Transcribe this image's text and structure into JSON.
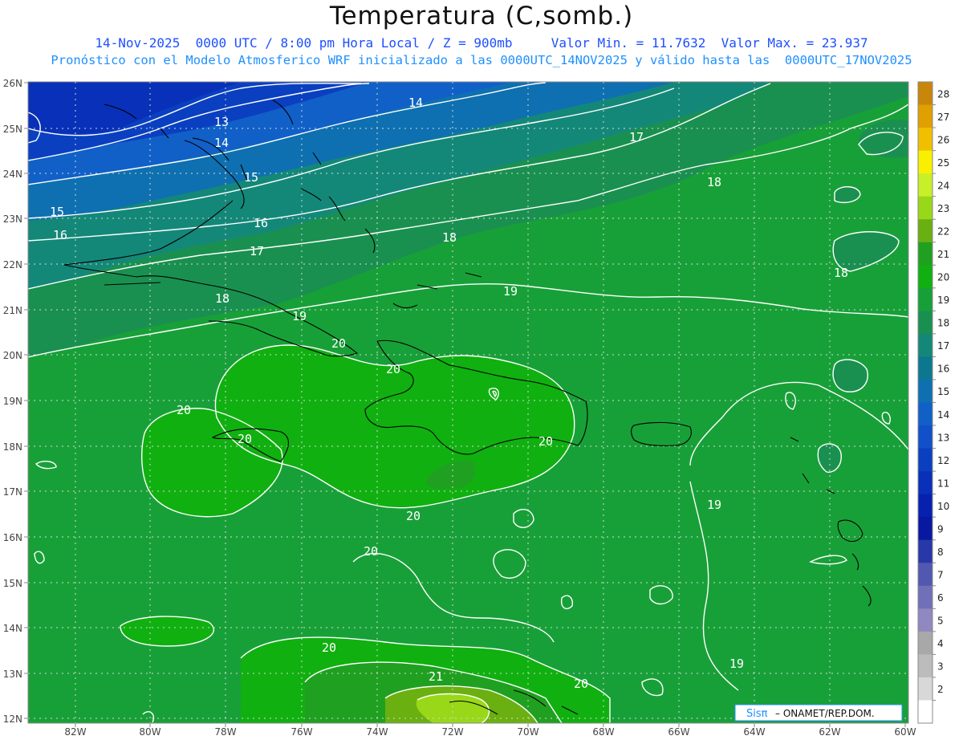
{
  "header": {
    "title": "Temperatura (C,somb.)",
    "line1": "14-Nov-2025  0000 UTC / 8:00 pm Hora Local / Z = 900mb     Valor Min. = 11.7632  Valor Max. = 23.937",
    "line2": "Pronóstico con el Modelo Atmosferico WRF inicializado a las 0000UTC_14NOV2025 y válido hasta las  0000UTC_17NOV2025"
  },
  "map": {
    "lat_labels": [
      "26N",
      "25N",
      "24N",
      "23N",
      "22N",
      "21N",
      "20N",
      "19N",
      "18N",
      "17N",
      "16N",
      "15N",
      "14N",
      "13N",
      "12N"
    ],
    "lon_labels": [
      "82W",
      "80W",
      "78W",
      "76W",
      "74W",
      "72W",
      "70W",
      "68W",
      "66W",
      "64W",
      "62W",
      "60W"
    ],
    "contour_labels": [
      {
        "text": "14"
      },
      {
        "text": "13"
      },
      {
        "text": "14"
      },
      {
        "text": "15"
      },
      {
        "text": "15"
      },
      {
        "text": "16"
      },
      {
        "text": "16"
      },
      {
        "text": "17"
      },
      {
        "text": "17"
      },
      {
        "text": "18"
      },
      {
        "text": "18"
      },
      {
        "text": "18"
      },
      {
        "text": "18"
      },
      {
        "text": "19"
      },
      {
        "text": "19"
      },
      {
        "text": "20"
      },
      {
        "text": "20"
      },
      {
        "text": "20"
      },
      {
        "text": "20"
      },
      {
        "text": "20"
      },
      {
        "text": "20"
      },
      {
        "text": "19"
      },
      {
        "text": "20"
      },
      {
        "text": "19"
      },
      {
        "text": "20"
      },
      {
        "text": "21"
      },
      {
        "text": "20"
      }
    ]
  },
  "colorbar": {
    "values": [
      "28",
      "27",
      "26",
      "25",
      "24",
      "23",
      "22",
      "21",
      "20",
      "19",
      "18",
      "17",
      "16",
      "15",
      "14",
      "13",
      "12",
      "11",
      "10",
      "9",
      "8",
      "7",
      "6",
      "5",
      "4",
      "3",
      "2"
    ],
    "colors": [
      "#c8860a",
      "#e0a000",
      "#f0c000",
      "#f8f000",
      "#c8f028",
      "#98d818",
      "#6ab010",
      "#20a020",
      "#10b010",
      "#18a038",
      "#1a9050",
      "#148878",
      "#0c7890",
      "#0e70b0",
      "#1060c8",
      "#1050c8",
      "#0a40c0",
      "#0830b8",
      "#0620b0",
      "#0818a0",
      "#2838a8",
      "#5058b0",
      "#7070b8",
      "#9088c0",
      "#a8a8a8",
      "#bcbcbc",
      "#d8d8d8",
      "#ffffff"
    ]
  },
  "credit": {
    "prefix": "Sisπ",
    "text": " – ONAMET/REP.DOM."
  }
}
